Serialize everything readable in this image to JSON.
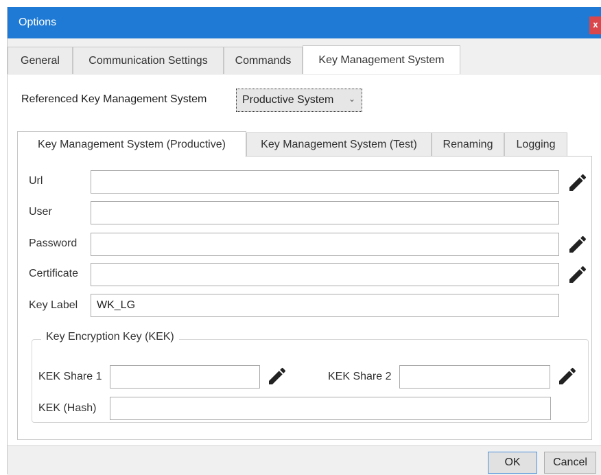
{
  "window": {
    "title": "Options",
    "close_label": "x"
  },
  "main_tabs": [
    {
      "label": "General"
    },
    {
      "label": "Communication Settings"
    },
    {
      "label": "Commands"
    },
    {
      "label": "Key Management System"
    }
  ],
  "referenced_kms": {
    "label": "Referenced Key Management System",
    "selected": "Productive System"
  },
  "sub_tabs": [
    {
      "label": "Key Management System (Productive)"
    },
    {
      "label": "Key Management System (Test)"
    },
    {
      "label": "Renaming"
    },
    {
      "label": "Logging"
    }
  ],
  "fields": {
    "url": {
      "label": "Url",
      "value": ""
    },
    "user": {
      "label": "User",
      "value": ""
    },
    "password": {
      "label": "Password",
      "value": ""
    },
    "certificate": {
      "label": "Certificate",
      "value": ""
    },
    "key_label": {
      "label": "Key Label",
      "value": "WK_LG"
    }
  },
  "kek_group": {
    "title": "Key Encryption Key (KEK)",
    "share1": {
      "label": "KEK Share 1",
      "value": ""
    },
    "share2": {
      "label": "KEK Share 2",
      "value": ""
    },
    "hash": {
      "label": "KEK (Hash)",
      "value": ""
    }
  },
  "buttons": {
    "ok": "OK",
    "cancel": "Cancel"
  },
  "icons": {
    "edit": "pencil-icon"
  },
  "colors": {
    "titlebar": "#1e7ad4",
    "close": "#d9474c",
    "default_button_border": "#4a90d9"
  }
}
